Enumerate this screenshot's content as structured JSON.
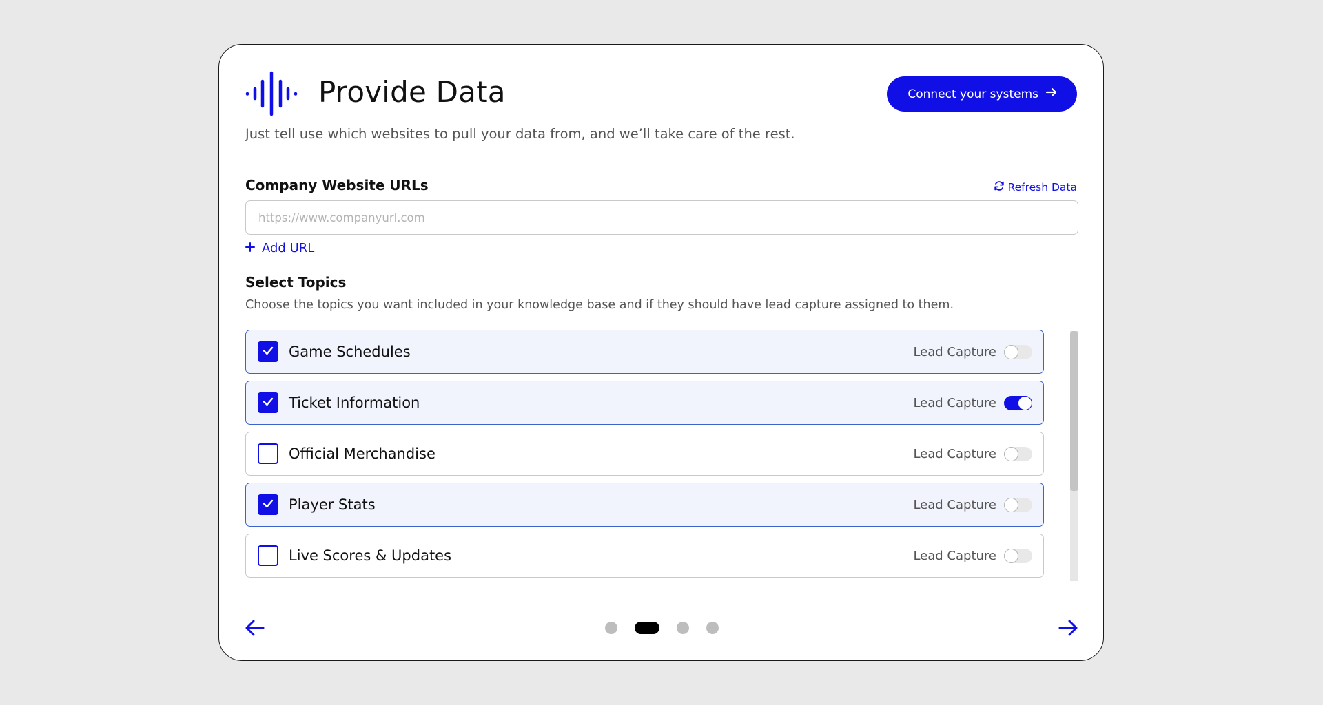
{
  "header": {
    "title": "Provide Data",
    "subtitle": "Just tell use which websites to pull your data from, and we’ll take care of the rest.",
    "connect_button_label": "Connect your systems",
    "logo_icon": "soundwave-icon"
  },
  "urls": {
    "label": "Company Website URLs",
    "refresh_label": "Refresh Data",
    "placeholder": "https://www.companyurl.com",
    "value": "",
    "add_label": "Add URL"
  },
  "topics": {
    "label": "Select Topics",
    "description": "Choose the topics you want included in your knowledge base and if they should have lead capture assigned to them.",
    "lead_capture_label": "Lead Capture",
    "items": [
      {
        "label": "Game Schedules",
        "checked": true,
        "lead_capture": false
      },
      {
        "label": "Ticket Information",
        "checked": true,
        "lead_capture": true
      },
      {
        "label": "Official Merchandise",
        "checked": false,
        "lead_capture": false
      },
      {
        "label": "Player Stats",
        "checked": true,
        "lead_capture": false
      },
      {
        "label": "Live Scores & Updates",
        "checked": false,
        "lead_capture": false
      }
    ]
  },
  "pagination": {
    "total_steps": 4,
    "current_step": 2
  },
  "colors": {
    "accent": "#1010e6",
    "checked_row_bg": "#f1f4fd",
    "checked_row_border": "#3c62cc",
    "page_bg": "#e9e9e9"
  }
}
